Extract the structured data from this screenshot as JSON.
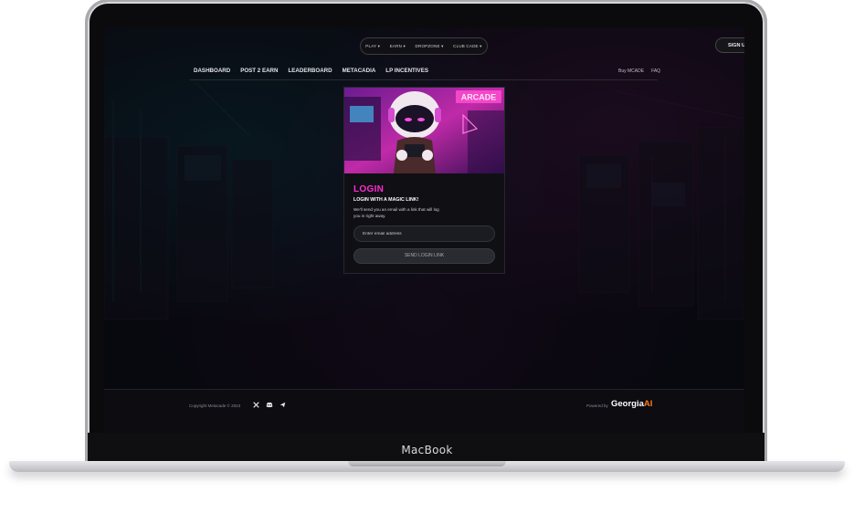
{
  "device": {
    "brand": "MacBook"
  },
  "top_menu": {
    "items": [
      {
        "label": "PLAY ▾"
      },
      {
        "label": "EARN ▾"
      },
      {
        "label": "DROPZONE ▾"
      },
      {
        "label": "CLUB CADE ▾"
      }
    ],
    "signup_label": "SIGN UP"
  },
  "nav": {
    "items": [
      {
        "label": "DASHBOARD"
      },
      {
        "label": "POST 2 EARN"
      },
      {
        "label": "LEADERBOARD"
      },
      {
        "label": "METACADIA"
      },
      {
        "label": "LP INCENTIVES"
      }
    ],
    "right": [
      {
        "label": "Buy MCADE"
      },
      {
        "label": "FAQ"
      }
    ]
  },
  "login": {
    "image_sign": "ARCADE",
    "title": "LOGIN",
    "subtitle": "LOGIN WITH A MAGIC LINK!",
    "description": "We'll send you an email with a link that will log you in right away.",
    "email_placeholder": "Enter email address",
    "send_label": "SEND LOGIN LINK"
  },
  "footer": {
    "copyright": "Copyright Metacade © 2023",
    "social_icons": [
      "x-icon",
      "discord-icon",
      "telegram-icon"
    ],
    "powered_by": "Powered by",
    "partner_name": "Georgia",
    "partner_suffix": "AI"
  },
  "colors": {
    "accent": "#ff2bd1",
    "partner_suffix": "#ff7a1a",
    "background": "#0b0a10"
  }
}
